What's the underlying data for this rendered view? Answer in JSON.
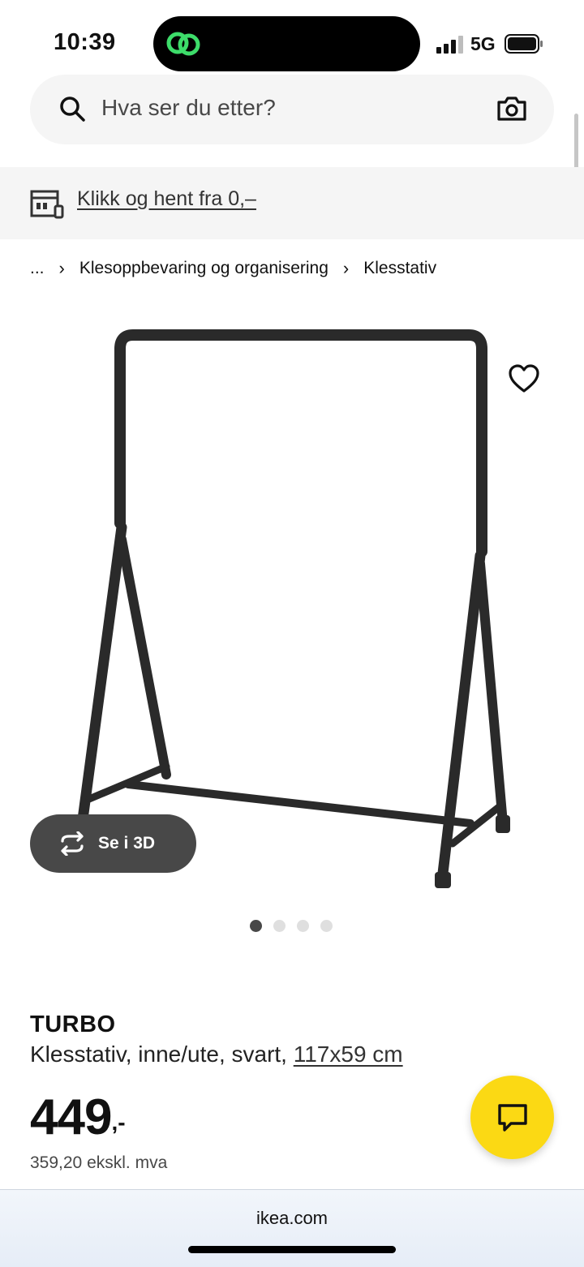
{
  "status_bar": {
    "time": "10:39",
    "network": "5G"
  },
  "search": {
    "placeholder": "Hva ser du etter?"
  },
  "store_banner": {
    "link_text": "Klikk og hent fra 0,–"
  },
  "breadcrumb": {
    "ellipsis": "...",
    "items": [
      "Klesoppbevaring og organisering",
      "Klesstativ"
    ]
  },
  "product": {
    "name": "TURBO",
    "description": "Klesstativ, inne/ute, svart, ",
    "dimensions": "117x59 cm",
    "price": "449",
    "price_suffix": ",-",
    "price_ex_vat": "359,20 ekskl. mva"
  },
  "view_3d": {
    "label": "Se i 3D"
  },
  "gallery": {
    "image_count": 4,
    "active_index": 0
  },
  "browser": {
    "url": "ikea.com"
  },
  "colors": {
    "chat_yellow": "#fbd914",
    "button_dark": "#484848",
    "banner_bg": "#f5f5f5"
  },
  "icons": [
    "search-icon",
    "camera-icon",
    "store-icon",
    "heart-icon",
    "rotate-3d-icon",
    "chat-icon",
    "signal-icon",
    "battery-icon"
  ]
}
